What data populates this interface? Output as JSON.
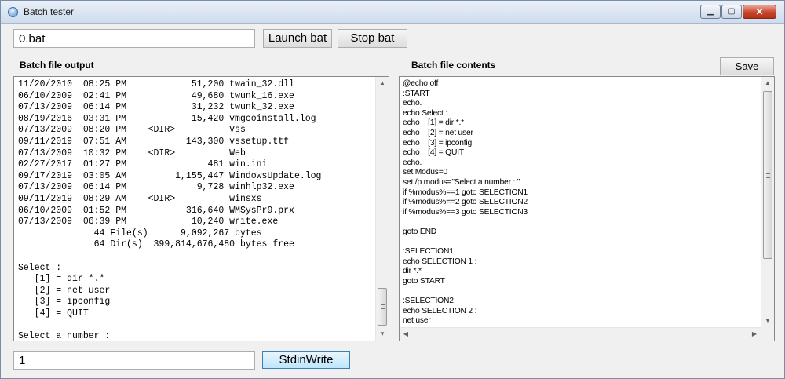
{
  "window": {
    "title": "Batch tester"
  },
  "toolbar": {
    "bat_path_value": "0.bat",
    "launch_label": "Launch bat",
    "stop_label": "Stop bat",
    "save_label": "Save"
  },
  "labels": {
    "output": "Batch file output",
    "contents": "Batch file contents"
  },
  "output_text": "11/20/2010  08:25 PM            51,200 twain_32.dll\n06/10/2009  02:41 PM            49,680 twunk_16.exe\n07/13/2009  06:14 PM            31,232 twunk_32.exe\n08/19/2016  03:31 PM            15,420 vmgcoinstall.log\n07/13/2009  08:20 PM    <DIR>          Vss\n09/11/2019  07:51 AM           143,300 vssetup.ttf\n07/13/2009  10:32 PM    <DIR>          Web\n02/27/2017  01:27 PM               481 win.ini\n09/17/2019  03:05 AM         1,155,447 WindowsUpdate.log\n07/13/2009  06:14 PM             9,728 winhlp32.exe\n09/11/2019  08:29 AM    <DIR>          winsxs\n06/10/2009  01:52 PM           316,640 WMSysPr9.prx\n07/13/2009  06:39 PM            10,240 write.exe\n              44 File(s)      9,092,267 bytes\n              64 Dir(s)  399,814,676,480 bytes free\n\nSelect :\n   [1] = dir *.*\n   [2] = net user\n   [3] = ipconfig\n   [4] = QUIT\n\nSelect a number :",
  "contents_text": "@echo off\n:START\necho.\necho Select :\necho    [1] = dir *.*\necho    [2] = net user\necho    [3] = ipconfig\necho    [4] = QUIT\necho.\nset Modus=0\nset /p modus=\"Select a number : \"\nif %modus%==1 goto SELECTION1\nif %modus%==2 goto SELECTION2\nif %modus%==3 goto SELECTION3\n\ngoto END\n\n:SELECTION1\necho SELECTION 1 :\ndir *.*\ngoto START\n\n:SELECTION2\necho SELECTION 2 :\nnet user",
  "stdin": {
    "value": "1",
    "write_label": "StdinWrite"
  },
  "icons": {
    "app": "app-icon",
    "minimize": "minimize-icon",
    "maximize": "maximize-icon",
    "close": "close-icon"
  }
}
